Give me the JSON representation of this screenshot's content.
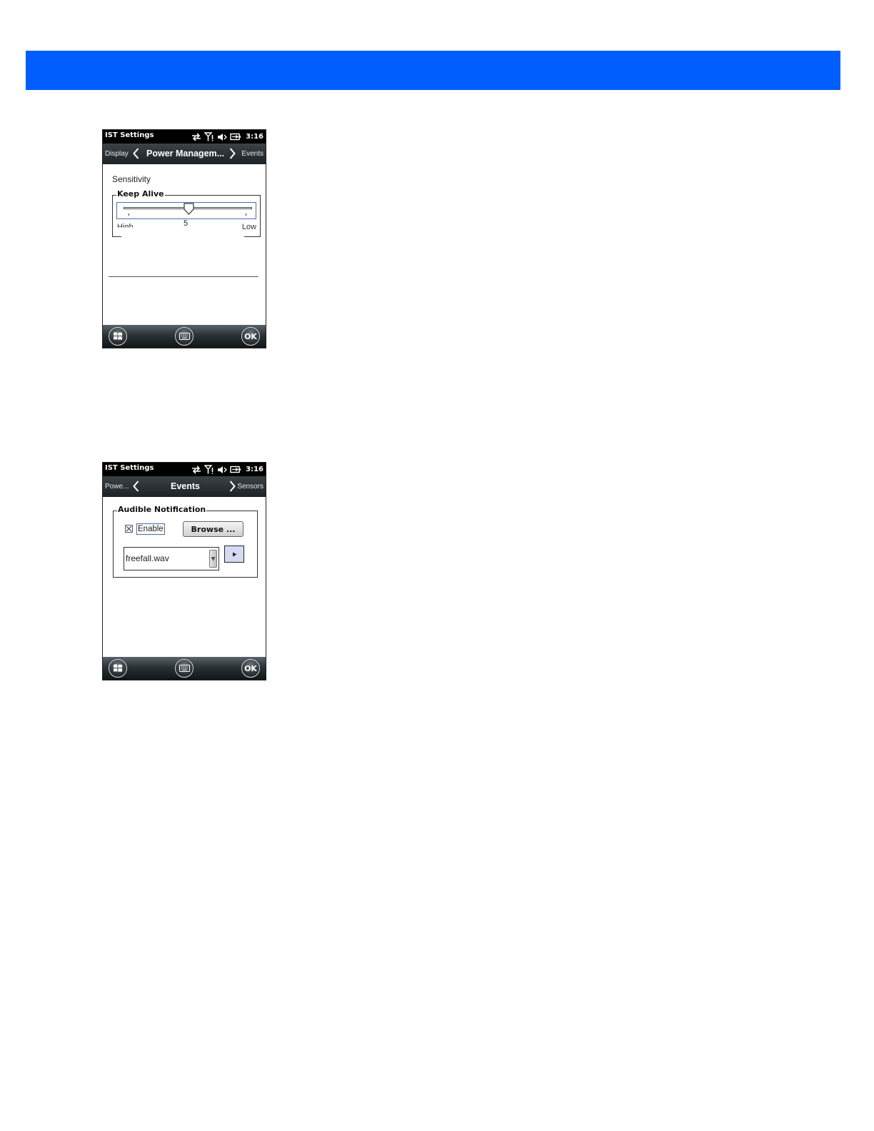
{
  "screens": [
    {
      "status": {
        "title": "IST Settings",
        "time": "3:16"
      },
      "nav": {
        "prev": "Display",
        "title": "Power Managem...",
        "next": "Events"
      },
      "content": {
        "section_label": "Sensitivity",
        "group_title": "Keep Alive",
        "slider": {
          "value": "5",
          "min_label": "High",
          "max_label": "Low",
          "level_fraction": 0.5
        }
      },
      "softkeys": {
        "ok": "OK"
      }
    },
    {
      "status": {
        "title": "IST Settings",
        "time": "3:16"
      },
      "nav": {
        "prev": "Powe...",
        "title": "Events",
        "next": "Sensors"
      },
      "content": {
        "group_title": "Audible Notification",
        "enable_label": "Enable",
        "enable_checked": true,
        "browse_label": "Browse ...",
        "file_value": "freefall.wav"
      },
      "softkeys": {
        "ok": "OK"
      }
    }
  ],
  "colors": {
    "band": "#005eff",
    "nav_bar": "#1c2225",
    "status_bar": "#000000"
  }
}
